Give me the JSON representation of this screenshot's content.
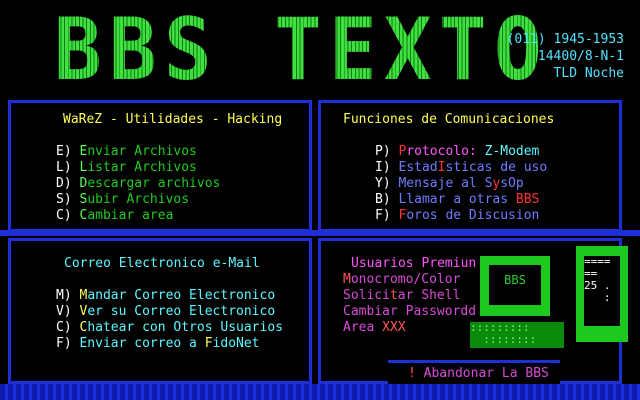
{
  "header": {
    "title": "BBS TEXTO",
    "phone": "(011) 1945-1953",
    "modem": "14400/8-N-1",
    "node": "TLD Noche"
  },
  "warez": {
    "heading": "WaReZ - Utilidades - Hacking",
    "items": [
      {
        "key": "E)",
        "hot": "E",
        "rest": "nviar Archivos"
      },
      {
        "key": "L)",
        "hot": "L",
        "rest": "istar Archivos"
      },
      {
        "key": "D)",
        "hot": "D",
        "rest": "escargar archivos"
      },
      {
        "key": "S)",
        "hot": "S",
        "rest": "ubir Archivos"
      },
      {
        "key": "C)",
        "hot": "C",
        "rest": "ambiar area"
      }
    ]
  },
  "funciones": {
    "heading": "Funciones de Comunicaciones",
    "items": [
      {
        "key": "P)",
        "a": "",
        "hot": "P",
        "rest": "rotocolo: ",
        "extra": "Z-Modem"
      },
      {
        "key": "I)",
        "a": "Estad",
        "hot": "I",
        "rest": "sticas de uso",
        "extra": ""
      },
      {
        "key": "Y)",
        "a": "Mensaje al S",
        "hot": "y",
        "rest": "sOp",
        "extra": ""
      },
      {
        "key": "B)",
        "a": "Llamar a otras ",
        "hot": "BBS",
        "rest": "",
        "extra": ""
      },
      {
        "key": "F)",
        "a": "",
        "hot": "F",
        "rest": "oros de Discusion",
        "extra": ""
      }
    ]
  },
  "correo": {
    "heading": "Correo Electronico e-Mail",
    "items": [
      {
        "key": "M)",
        "a": "",
        "hot": "M",
        "rest": "andar Correo Electronico"
      },
      {
        "key": "V)",
        "a": "",
        "hot": "V",
        "rest": "er su Correo Electronico"
      },
      {
        "key": "C)",
        "a": "",
        "hot": "C",
        "rest": "hatear con Otros Usuarios"
      },
      {
        "key": "F)",
        "a": "Enviar correo a ",
        "hot": "F",
        "rest": "idoNet"
      }
    ]
  },
  "premium": {
    "heading": "Usuarios Premiun",
    "items": [
      {
        "a": "",
        "hot": "M",
        "rest": "onocromo/Color"
      },
      {
        "a": "Solici",
        "hot": "t",
        "rest": "ar Shell"
      },
      {
        "a": "Cambiar Passwordd",
        "hot": "",
        "rest": ""
      },
      {
        "a": "Area ",
        "hot": "XXX",
        "rest": ""
      }
    ]
  },
  "art": {
    "monitor_label": "BBS",
    "keyboard": ":::::::::\n  ::::::::",
    "tower_screen": "====\n==\n25 .\n   :"
  },
  "exit": {
    "icon": "!",
    "label": "Abandonar La BBS"
  },
  "colors": {
    "frame": "#1f2fd8",
    "title": "#2ecc33",
    "accent": "#4fe3ff"
  }
}
